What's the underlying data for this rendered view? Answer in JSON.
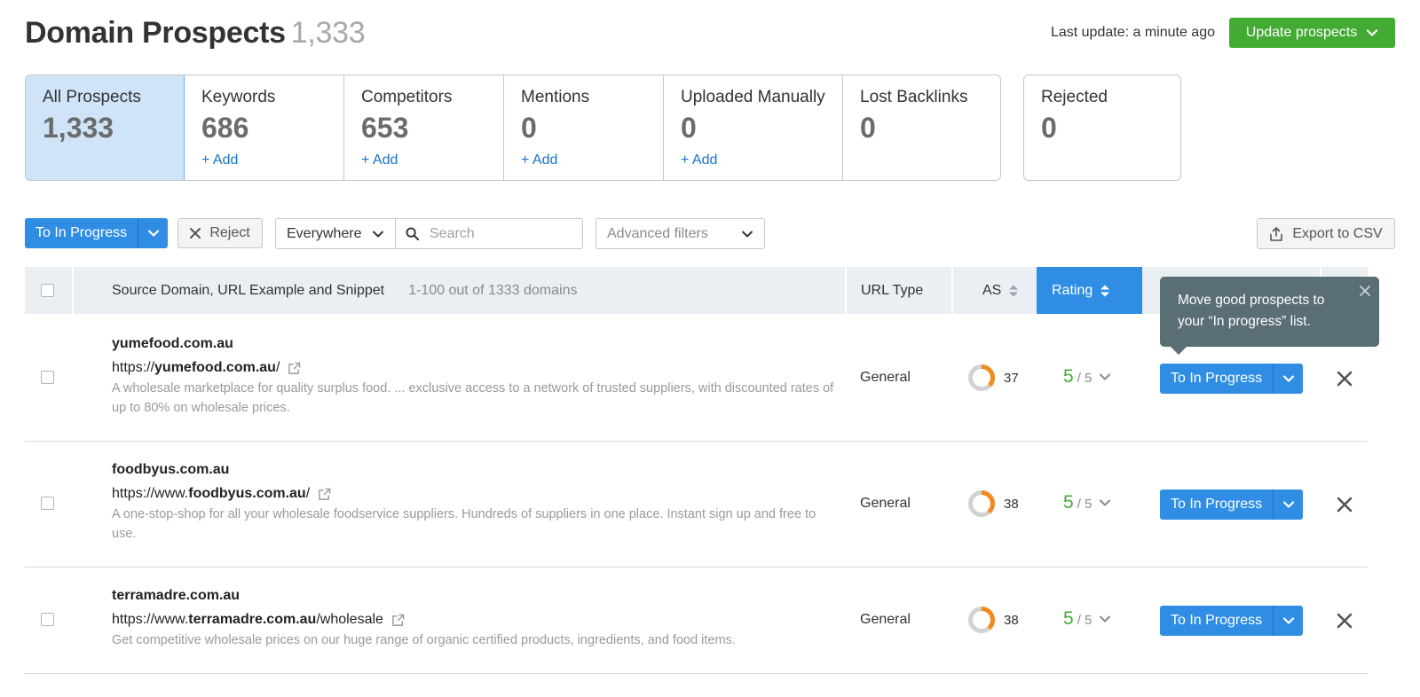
{
  "header": {
    "title": "Domain Prospects",
    "count": "1,333",
    "last_update": "Last update: a minute ago",
    "update_button": "Update prospects"
  },
  "stats": [
    {
      "label": "All Prospects",
      "value": "1,333",
      "add": ""
    },
    {
      "label": "Keywords",
      "value": "686",
      "add": "+ Add"
    },
    {
      "label": "Competitors",
      "value": "653",
      "add": "+ Add"
    },
    {
      "label": "Mentions",
      "value": "0",
      "add": "+ Add"
    },
    {
      "label": "Uploaded Manually",
      "value": "0",
      "add": "+ Add"
    },
    {
      "label": "Lost Backlinks",
      "value": "0",
      "add": ""
    }
  ],
  "rejected": {
    "label": "Rejected",
    "value": "0"
  },
  "toolbar": {
    "to_in_progress": "To In Progress",
    "reject": "Reject",
    "scope": "Everywhere",
    "search_placeholder": "Search",
    "advanced_filters": "Advanced filters",
    "export": "Export to CSV"
  },
  "table": {
    "col_source": "Source Domain, URL Example and Snippet",
    "range": "1-100 out of 1333 domains",
    "col_url_type": "URL Type",
    "col_as": "AS",
    "col_rating": "Rating"
  },
  "tooltip": {
    "text": "Move good prospects to your “In progress” list."
  },
  "rows": [
    {
      "domain": "yumefood.com.au",
      "url_prefix": "https://",
      "url_bold": "yumefood.com.au",
      "url_suffix": "/",
      "snippet": "A wholesale marketplace for quality surplus food. ... exclusive access to a network of trusted suppliers, with discounted rates of up to 80% on wholesale prices.",
      "url_type": "General",
      "as": "37",
      "rating": "5",
      "rating_max": "/ 5",
      "action": "To In Progress"
    },
    {
      "domain": "foodbyus.com.au",
      "url_prefix": "https://www.",
      "url_bold": "foodbyus.com.au",
      "url_suffix": "/",
      "snippet": "A one-stop-shop for all your wholesale foodservice suppliers. Hundreds of suppliers in one place. Instant sign up and free to use.",
      "url_type": "General",
      "as": "38",
      "rating": "5",
      "rating_max": "/ 5",
      "action": "To In Progress"
    },
    {
      "domain": "terramadre.com.au",
      "url_prefix": "https://www.",
      "url_bold": "terramadre.com.au",
      "url_suffix": "/wholesale",
      "snippet": "Get competitive wholesale prices on our huge range of organic certified products, ingredients, and food items.",
      "url_type": "General",
      "as": "38",
      "rating": "5",
      "rating_max": "/ 5",
      "action": "To In Progress"
    }
  ],
  "colors": {
    "primary_blue": "#2f8ee3",
    "green": "#43ab34",
    "link_blue": "#1a73c8",
    "tooltip_bg": "#5a6e76",
    "as_ring_orange": "#f28a1e"
  }
}
